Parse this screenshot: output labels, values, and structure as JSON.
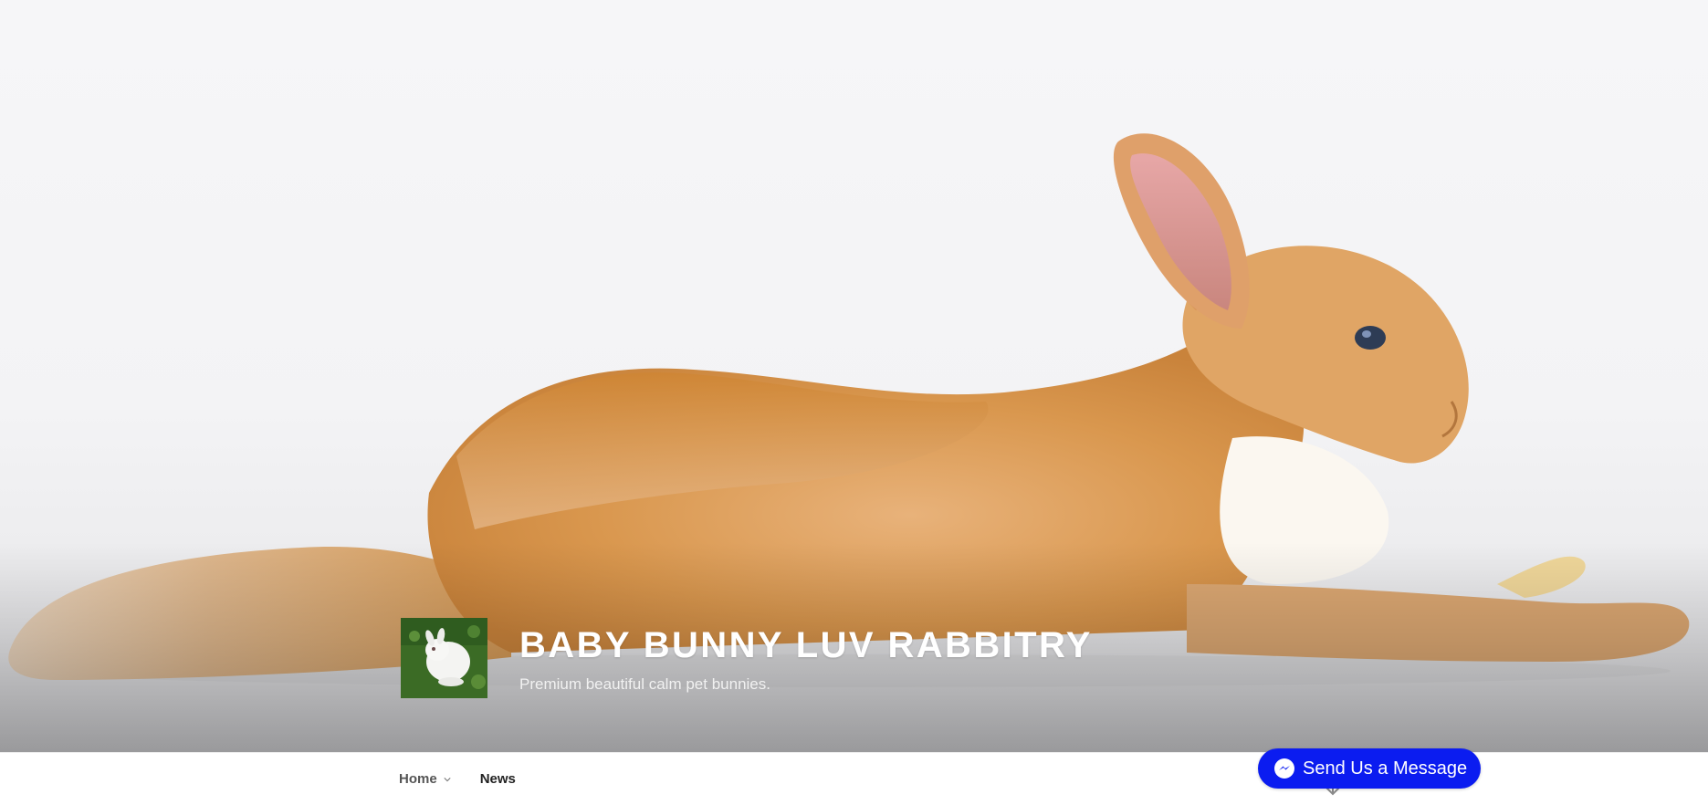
{
  "hero": {
    "image_subject": "orange rabbit stretched out lying on white background"
  },
  "branding": {
    "logo_alt": "white bunny on grass",
    "site_title": "BABY BUNNY LUV RABBITRY",
    "site_description": "Premium beautiful calm pet bunnies."
  },
  "nav": {
    "items": [
      {
        "label": "Home",
        "has_submenu": true
      },
      {
        "label": "News",
        "has_submenu": false,
        "current": true
      }
    ]
  },
  "messenger": {
    "label": "Send Us a Message",
    "color": "#0b1cf0"
  },
  "icons": {
    "chevron": "chevron-down-icon",
    "scroll": "arrow-down-icon",
    "messenger": "messenger-icon"
  }
}
